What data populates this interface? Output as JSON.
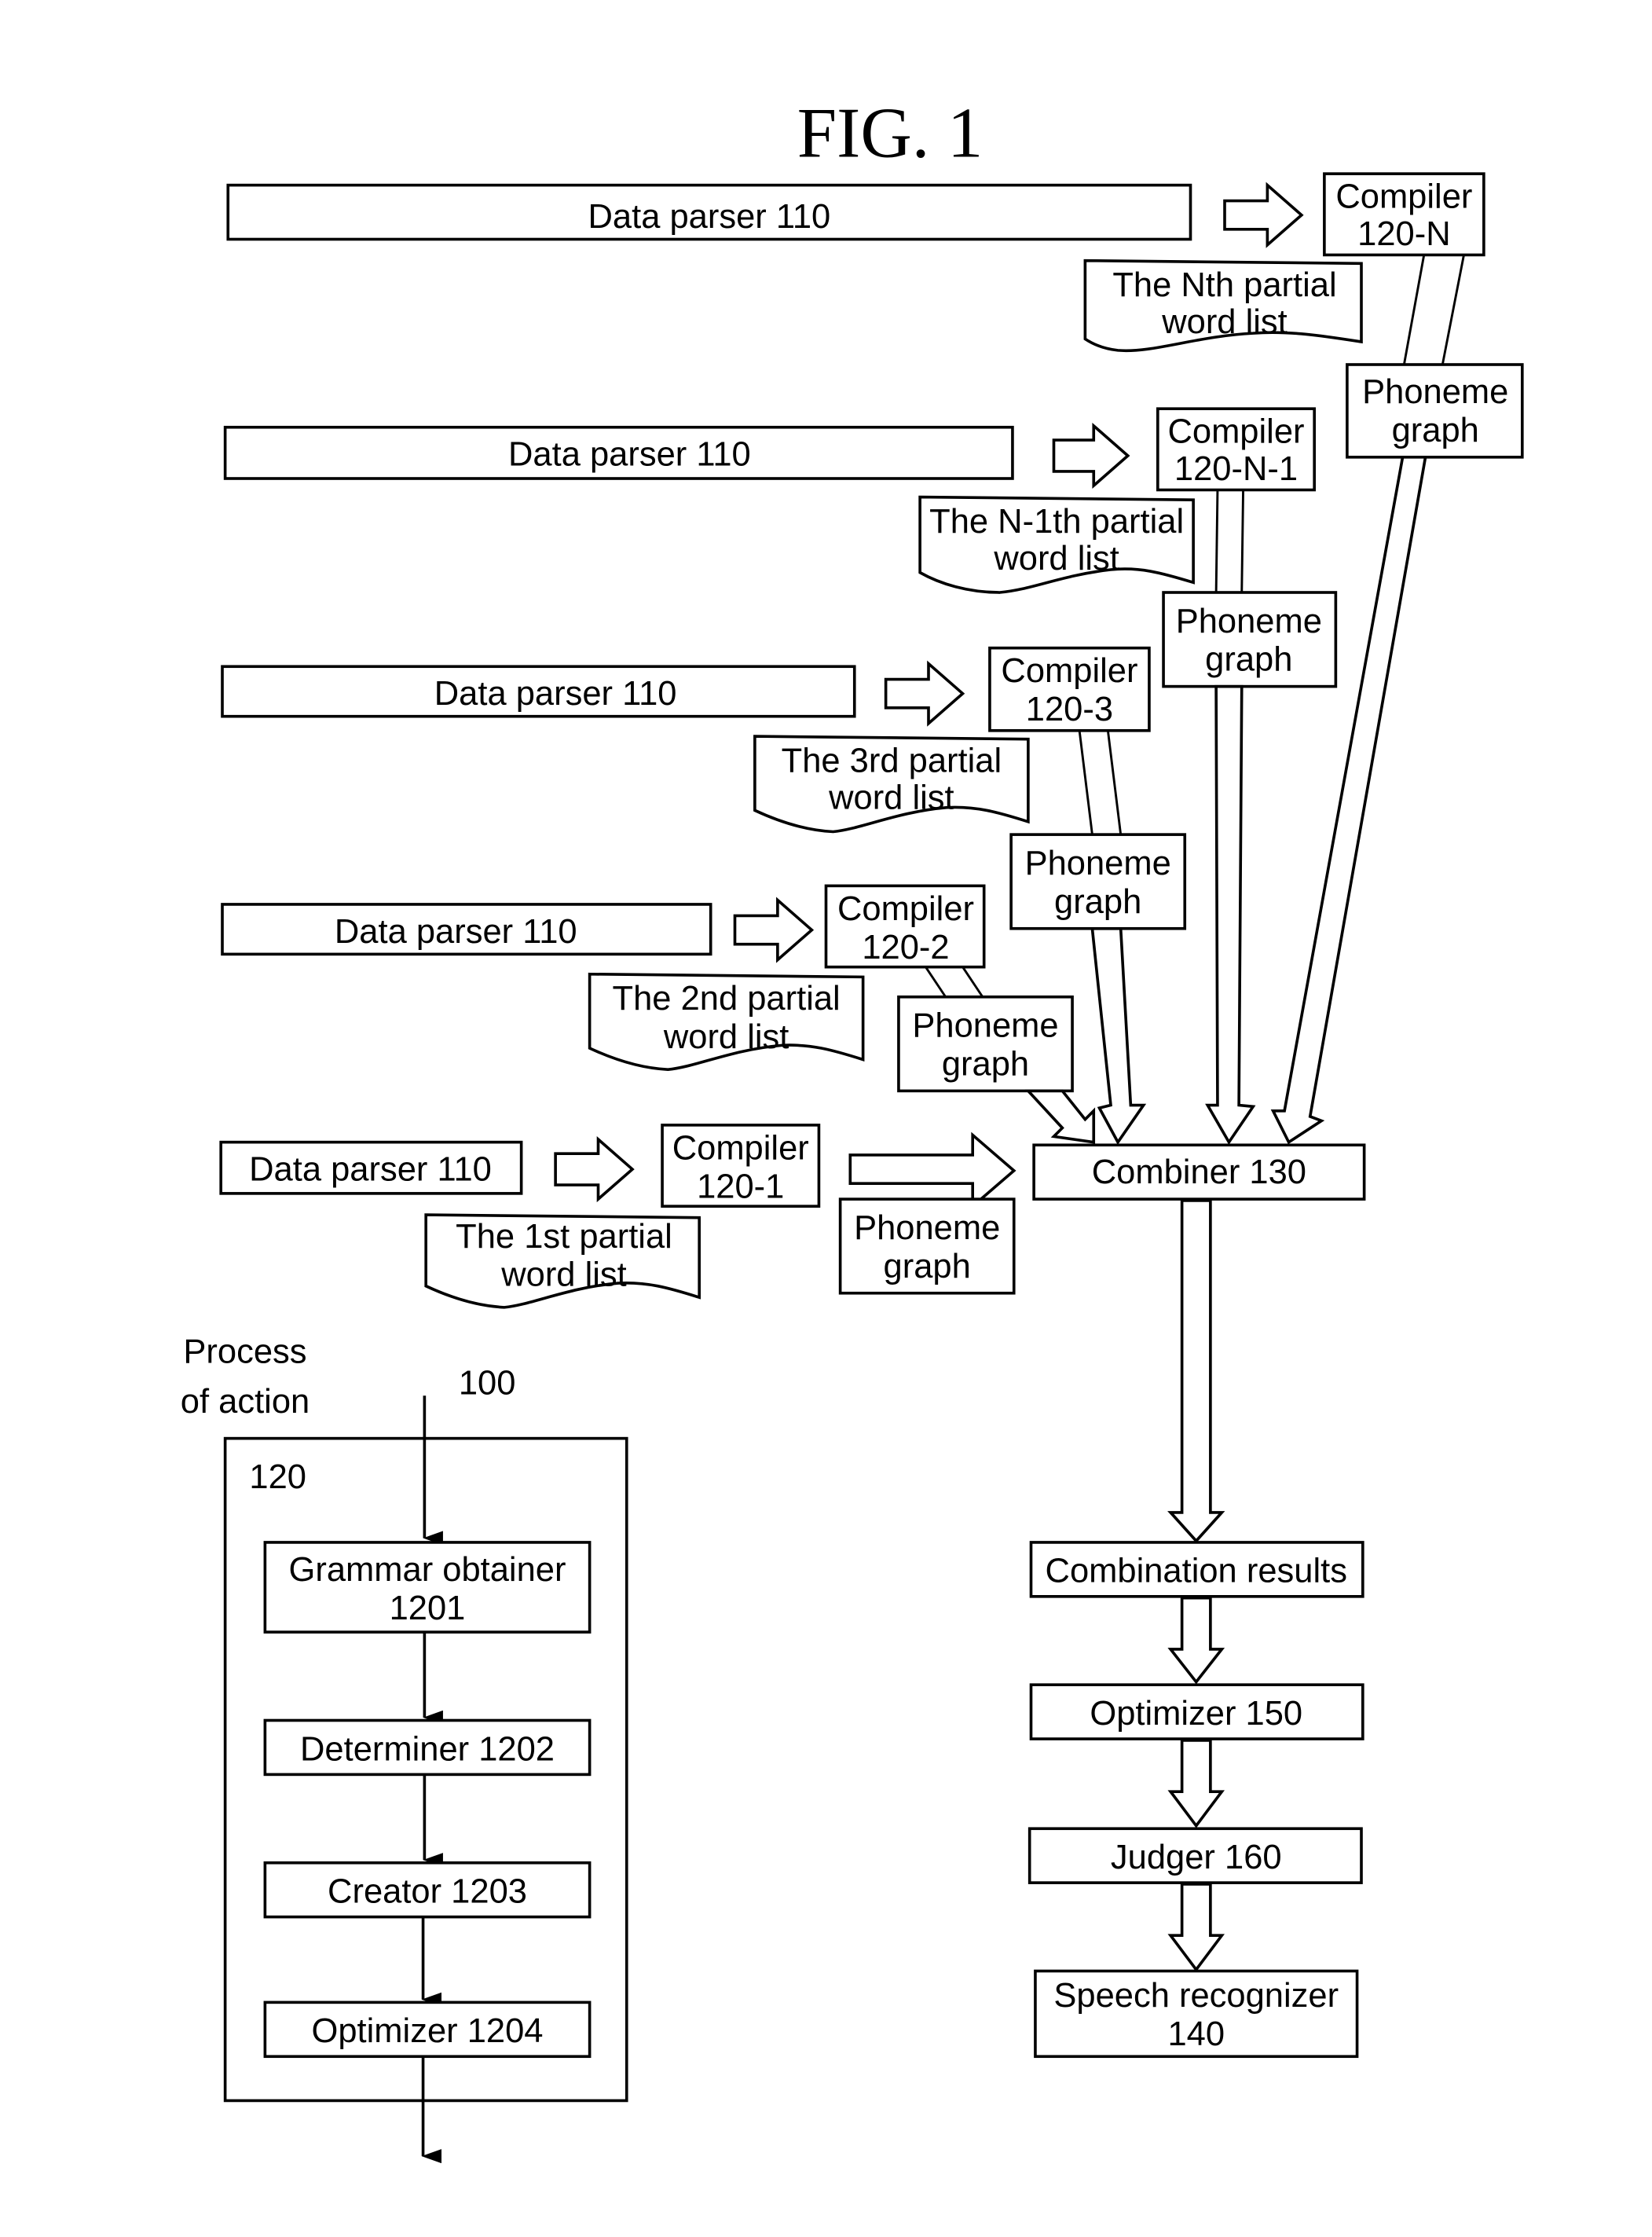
{
  "figure": {
    "title": "FIG. 1"
  },
  "rows": [
    {
      "parser": "Data parser 110",
      "compiler": [
        "Compiler",
        "120-N"
      ],
      "word_list": [
        "The Nth partial",
        "word list"
      ],
      "phoneme": [
        "Phoneme",
        "graph"
      ]
    },
    {
      "parser": "Data parser 110",
      "compiler": [
        "Compiler",
        "120-N-1"
      ],
      "word_list": [
        "The N-1th partial",
        "word list"
      ],
      "phoneme": [
        "Phoneme",
        "graph"
      ]
    },
    {
      "parser": "Data parser 110",
      "compiler": [
        "Compiler",
        "120-3"
      ],
      "word_list": [
        "The 3rd partial",
        "word list"
      ],
      "phoneme": [
        "Phoneme",
        "graph"
      ]
    },
    {
      "parser": "Data parser 110",
      "compiler": [
        "Compiler",
        "120-2"
      ],
      "word_list": [
        "The 2nd partial",
        "word list"
      ],
      "phoneme": [
        "Phoneme",
        "graph"
      ]
    },
    {
      "parser": "Data parser 110",
      "compiler": [
        "Compiler",
        "120-1"
      ],
      "word_list": [
        "The 1st partial",
        "word list"
      ],
      "phoneme": [
        "Phoneme",
        "graph"
      ]
    }
  ],
  "pipeline": {
    "combiner": "Combiner 130",
    "combination_results": "Combination results",
    "optimizer": "Optimizer 150",
    "judger": "Judger 160",
    "speech_recognizer": [
      "Speech recognizer",
      "140"
    ]
  },
  "process": {
    "caption": [
      "Process",
      "of action"
    ],
    "ref_100": "100",
    "ref_120": "120",
    "steps": [
      [
        "Grammar obtainer",
        "1201"
      ],
      [
        "Determiner 1202"
      ],
      [
        "Creator 1203"
      ],
      [
        "Optimizer 1204"
      ]
    ]
  }
}
